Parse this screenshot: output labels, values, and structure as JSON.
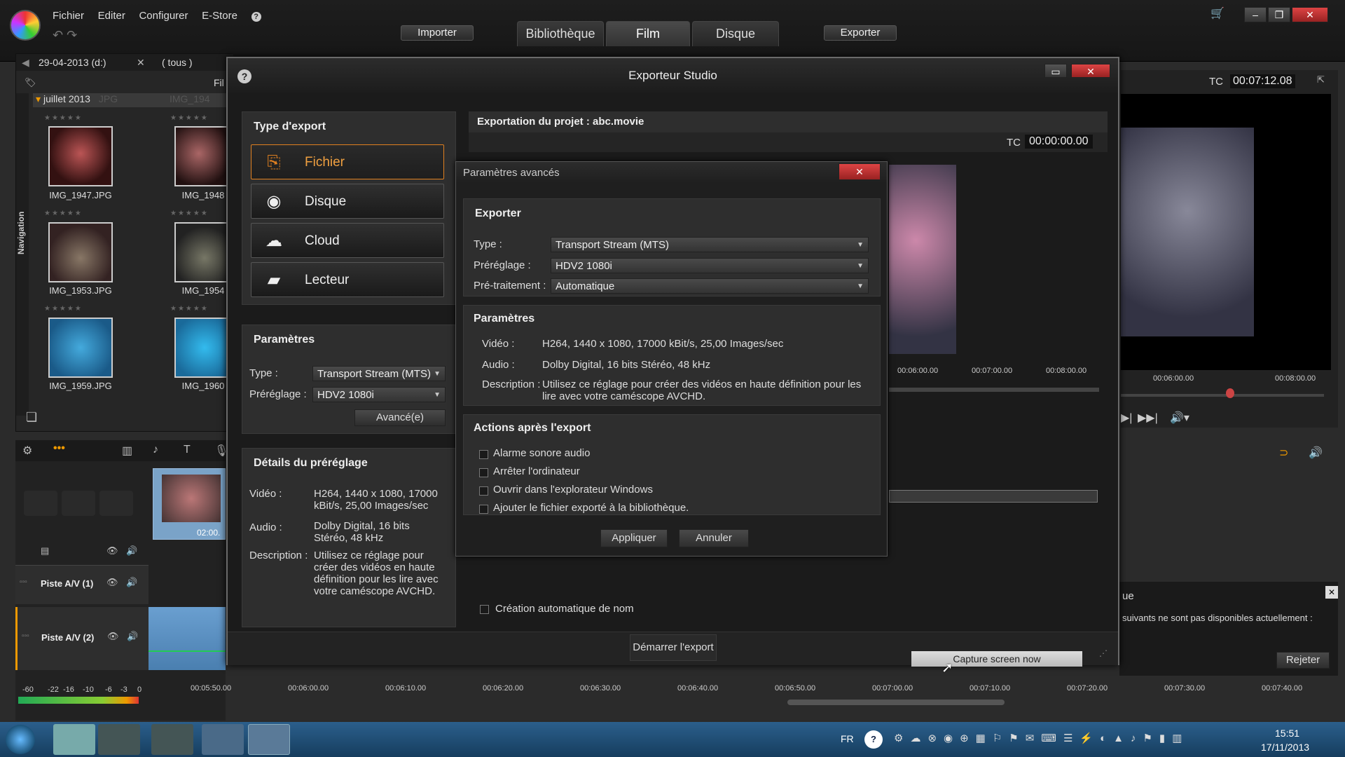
{
  "menu": {
    "items": [
      "Fichier",
      "Editer",
      "Configurer",
      "E-Store",
      "?"
    ]
  },
  "toolbar": {
    "import": "Importer",
    "export": "Exporter",
    "tabs": [
      "Bibliothèque",
      "Film",
      "Disque"
    ]
  },
  "library": {
    "tab1": "29-04-2013 (d:)",
    "tab2": "( tous )",
    "filter": "Fil",
    "group": "juillet 2013",
    "ghost": "JPG",
    "ghost2": "IMG_194",
    "nav": "Navigation",
    "items": [
      "IMG_1947.JPG",
      "IMG_1948",
      "IMG_1953.JPG",
      "IMG_1954",
      "IMG_1959.JPG",
      "IMG_1960"
    ]
  },
  "timeline": {
    "tracks": [
      "Piste A/V (1)",
      "Piste A/V (2)"
    ],
    "clip_time": "02:00.",
    "meter": [
      "-60",
      "-22",
      "-16",
      "-10",
      "-6",
      "-3",
      "0"
    ],
    "ticks": [
      "00:05:50.00",
      "00:06:00.00",
      "00:06:10.00",
      "00:06:20.00",
      "00:06:30.00",
      "00:06:40.00",
      "00:06:50.00",
      "00:07:00.00",
      "00:07:10.00",
      "00:07:20.00",
      "00:07:30.00",
      "00:07:40.00"
    ]
  },
  "preview": {
    "tc_label": "TC",
    "tc": "00:07:12.08",
    "ticks": [
      "00:06:00.00",
      "00:08:00.00"
    ]
  },
  "right_notice": {
    "title": "ue",
    "text": "suivants ne sont pas disponibles actuellement :",
    "reject": "Rejeter"
  },
  "dialog": {
    "title": "Exporteur Studio",
    "help": "?",
    "type_title": "Type d'export",
    "types": [
      "Fichier",
      "Disque",
      "Cloud",
      "Lecteur"
    ],
    "params_title": "Paramètres",
    "type_label": "Type :",
    "type_value": "Transport Stream (MTS)",
    "preset_label": "Préréglage :",
    "preset_value": "HDV2 1080i",
    "advanced": "Avancé(e)",
    "details_title": "Détails du préréglage",
    "video_label": "Vidéo :",
    "video_value": "H264, 1440 x 1080, 17000 kBit/s, 25,00 Images/sec",
    "audio_label": "Audio :",
    "audio_value": "Dolby Digital, 16 bits Stéréo, 48 kHz",
    "desc_label": "Description :",
    "desc_value": "Utilisez ce réglage pour créer des vidéos en haute définition pour les lire avec votre caméscope AVCHD.",
    "project": "Exportation du projet : abc.movie",
    "tc_label": "TC",
    "tc": "00:00:00.00",
    "ticks": [
      "00:06:00.00",
      "00:07:00.00",
      "00:08:00.00"
    ],
    "auto_name": "Création automatique de nom",
    "start": "Démarrer l'export",
    "capture": "Capture screen now"
  },
  "advanced": {
    "title": "Paramètres avancés",
    "export_title": "Exporter",
    "type_label": "Type :",
    "type_value": "Transport Stream (MTS)",
    "preset_label": "Préréglage :",
    "preset_value": "HDV2 1080i",
    "pre_label": "Pré-traitement :",
    "pre_value": "Automatique",
    "params_title": "Paramètres",
    "video_label": "Vidéo :",
    "video_value": "H264, 1440 x 1080, 17000 kBit/s, 25,00 Images/sec",
    "audio_label": "Audio :",
    "audio_value": "Dolby Digital, 16 bits Stéréo, 48 kHz",
    "desc_label": "Description :",
    "desc_value": "Utilisez ce réglage pour créer des vidéos en haute définition pour les lire avec votre caméscope AVCHD.",
    "actions_title": "Actions après l'export",
    "actions": [
      "Alarme sonore audio",
      "Arrêter l'ordinateur",
      "Ouvrir dans l'explorateur Windows",
      "Ajouter le fichier exporté à la bibliothèque."
    ],
    "apply": "Appliquer",
    "cancel": "Annuler"
  },
  "taskbar": {
    "lang": "FR",
    "time": "15:51",
    "date": "17/11/2013"
  }
}
